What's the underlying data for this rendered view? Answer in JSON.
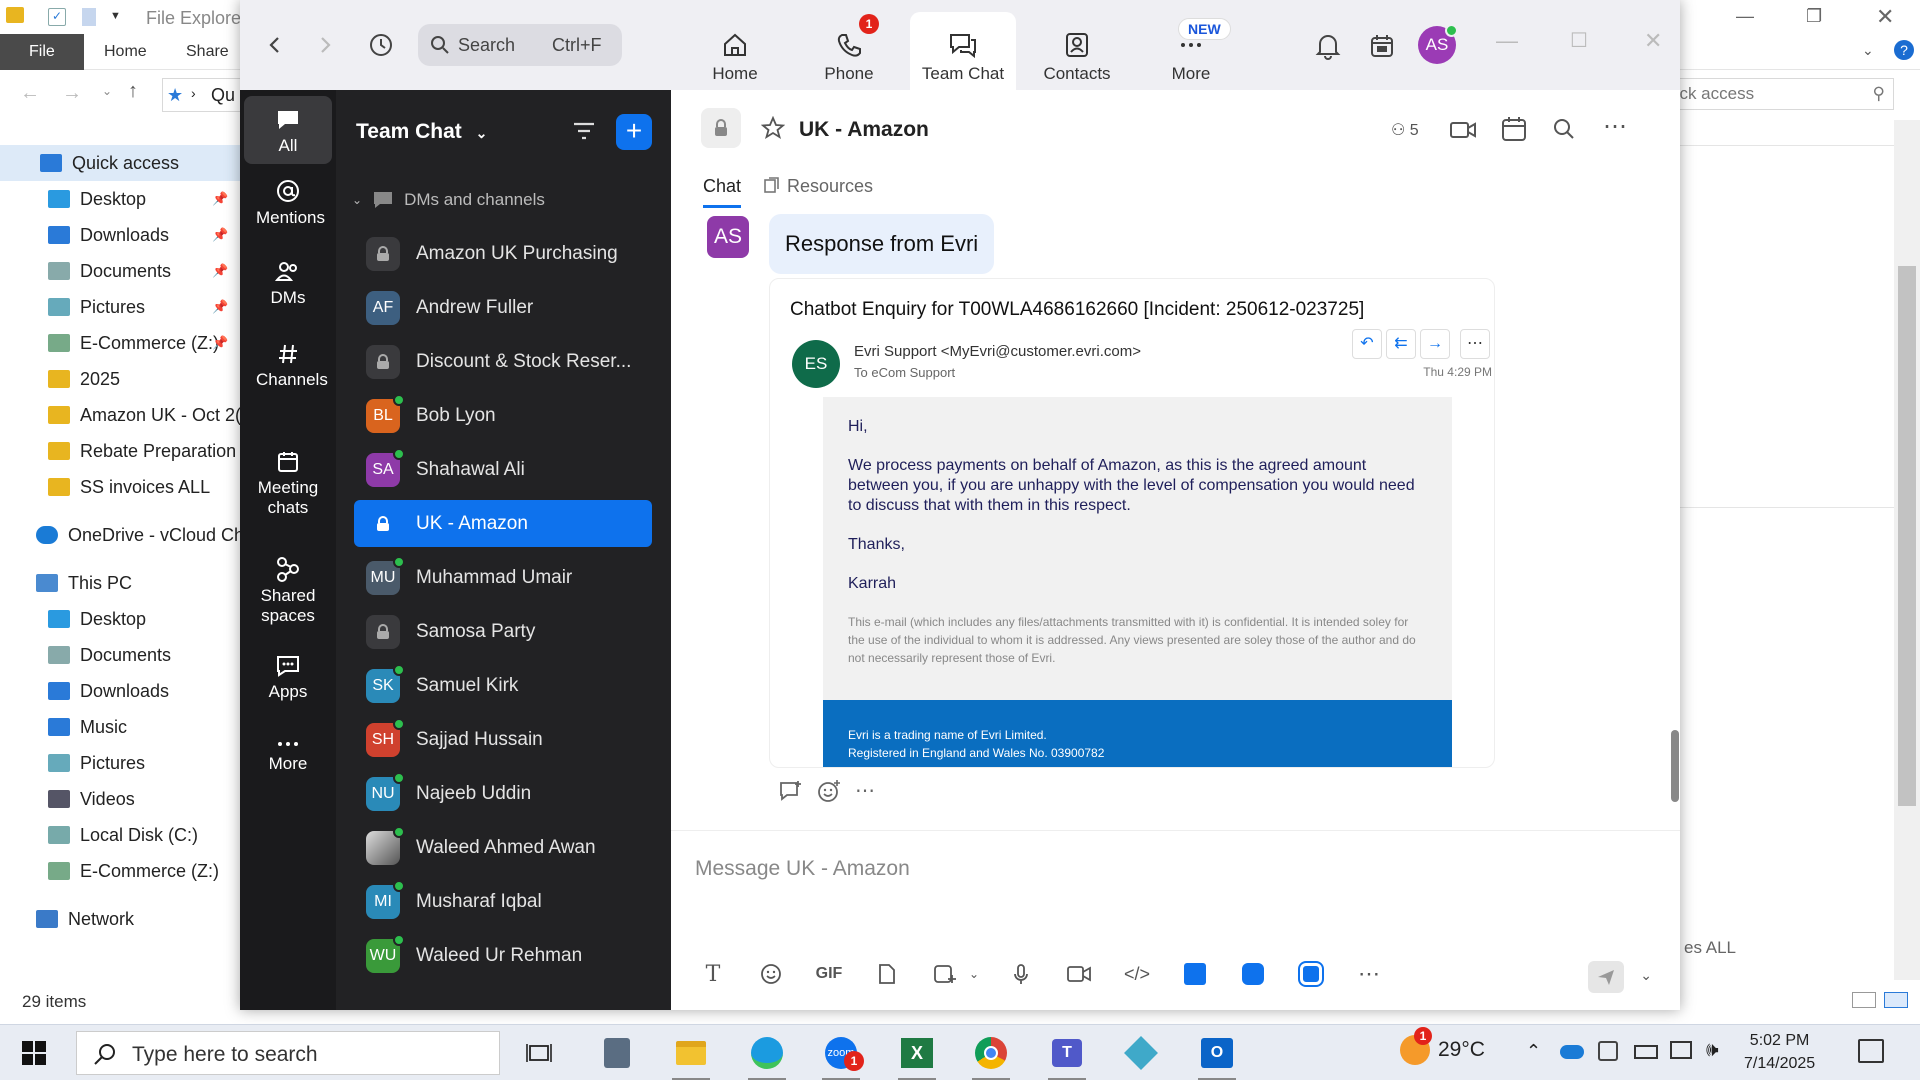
{
  "file_explorer": {
    "title": "File Explorer",
    "tabs": [
      "File",
      "Home",
      "Share"
    ],
    "address": "Qu",
    "quick_access_search": "Quick access",
    "nav_items": [
      {
        "label": "Quick access",
        "icon": "star-icon",
        "pinned": false
      },
      {
        "label": "Desktop",
        "icon": "desktop-folder-icon",
        "pinned": true
      },
      {
        "label": "Downloads",
        "icon": "downloads-icon",
        "pinned": true
      },
      {
        "label": "Documents",
        "icon": "documents-icon",
        "pinned": true
      },
      {
        "label": "Pictures",
        "icon": "pictures-icon",
        "pinned": true
      },
      {
        "label": "E-Commerce (Z:)",
        "icon": "network-drive-icon",
        "pinned": true
      },
      {
        "label": "2025",
        "icon": "folder-icon",
        "pinned": false
      },
      {
        "label": "Amazon UK - Oct 2(",
        "icon": "folder-icon",
        "pinned": false
      },
      {
        "label": "Rebate Preparation",
        "icon": "folder-icon",
        "pinned": false
      },
      {
        "label": "SS invoices ALL",
        "icon": "folder-icon",
        "pinned": false
      },
      {
        "label": "OneDrive - vCloud Ch",
        "icon": "onedrive-icon",
        "pinned": false
      },
      {
        "label": "This PC",
        "icon": "pc-icon",
        "pinned": false
      },
      {
        "label": "Desktop",
        "icon": "desktop-folder-icon",
        "pinned": false
      },
      {
        "label": "Documents",
        "icon": "documents-icon",
        "pinned": false
      },
      {
        "label": "Downloads",
        "icon": "downloads-icon",
        "pinned": false
      },
      {
        "label": "Music",
        "icon": "music-icon",
        "pinned": false
      },
      {
        "label": "Pictures",
        "icon": "pictures-icon",
        "pinned": false
      },
      {
        "label": "Videos",
        "icon": "videos-icon",
        "pinned": false
      },
      {
        "label": "Local Disk (C:)",
        "icon": "local-disk-icon",
        "pinned": false
      },
      {
        "label": "E-Commerce (Z:)",
        "icon": "network-drive-icon",
        "pinned": false
      },
      {
        "label": "Network",
        "icon": "network-icon",
        "pinned": false
      }
    ],
    "status": "29 items",
    "cut_text": "es ALL"
  },
  "zoom": {
    "search": {
      "label": "Search",
      "shortcut": "Ctrl+F"
    },
    "nav_tabs": [
      {
        "label": "Home",
        "icon": "home-icon",
        "active": false
      },
      {
        "label": "Phone",
        "icon": "phone-icon",
        "active": false,
        "badge": "1"
      },
      {
        "label": "Team Chat",
        "icon": "chat-icon",
        "active": true
      },
      {
        "label": "Contacts",
        "icon": "contacts-icon",
        "active": false
      },
      {
        "label": "More",
        "icon": "more-icon",
        "active": false
      }
    ],
    "new_badge": "NEW",
    "profile_initials": "AS",
    "rail": [
      {
        "label": "All",
        "icon": "all-chat-icon",
        "active": true
      },
      {
        "label": "Mentions",
        "icon": "at-icon",
        "active": false
      },
      {
        "label": "DMs",
        "icon": "people-icon",
        "active": false
      },
      {
        "label": "Channels",
        "icon": "hash-icon",
        "active": false
      },
      {
        "label": "Meeting chats",
        "icon": "calendar-icon",
        "active": false
      },
      {
        "label": "Shared spaces",
        "icon": "shared-spaces-icon",
        "active": false
      },
      {
        "label": "Apps",
        "icon": "apps-icon",
        "active": false
      },
      {
        "label": "More",
        "icon": "more-dots-icon",
        "active": false
      }
    ],
    "channel_list": {
      "title": "Team Chat",
      "section": "DMs and channels",
      "items": [
        {
          "label": "Amazon UK Purchasing",
          "type": "lock",
          "initials": "",
          "color": "#3a3a3d",
          "online": false
        },
        {
          "label": "Andrew Fuller",
          "type": "avatar",
          "initials": "AF",
          "color": "#3d5f80",
          "online": false
        },
        {
          "label": "Discount & Stock Reser...",
          "type": "lock",
          "initials": "",
          "color": "#3a3a3d",
          "online": false
        },
        {
          "label": "Bob Lyon",
          "type": "avatar",
          "initials": "BL",
          "color": "#d9641e",
          "online": true
        },
        {
          "label": "Shahawal Ali",
          "type": "avatar",
          "initials": "SA",
          "color": "#8e3aa8",
          "online": true
        },
        {
          "label": "UK - Amazon",
          "type": "lock",
          "initials": "",
          "color": "#0e72ed",
          "online": false,
          "active": true
        },
        {
          "label": "Muhammad Umair",
          "type": "avatar",
          "initials": "MU",
          "color": "#4a5a6a",
          "online": true
        },
        {
          "label": "Samosa Party",
          "type": "lock",
          "initials": "",
          "color": "#3a3a3d",
          "online": false
        },
        {
          "label": "Samuel Kirk",
          "type": "avatar",
          "initials": "SK",
          "color": "#2a8ab8",
          "online": true
        },
        {
          "label": "Sajjad Hussain",
          "type": "avatar",
          "initials": "SH",
          "color": "#d0412e",
          "online": true
        },
        {
          "label": "Najeeb Uddin",
          "type": "avatar",
          "initials": "NU",
          "color": "#2a8ab8",
          "online": true
        },
        {
          "label": "Waleed Ahmed Awan",
          "type": "photo",
          "initials": "",
          "color": "#777",
          "online": true
        },
        {
          "label": "Musharaf Iqbal",
          "type": "avatar",
          "initials": "MI",
          "color": "#2a8ab8",
          "online": true
        },
        {
          "label": "Waleed Ur Rehman",
          "type": "avatar",
          "initials": "WU",
          "color": "#3a9a3a",
          "online": true
        }
      ]
    },
    "chat": {
      "title": "UK - Amazon",
      "members": "5",
      "tabs": [
        "Chat",
        "Resources"
      ],
      "sender_initials": "AS",
      "bubble": "Response from Evri",
      "email_subject": "Chatbot Enquiry for T00WLA4686162660 [Incident: 250612-023725]",
      "from": "Evri Support <MyEvri@customer.evri.com>",
      "to": "To  eCom Support",
      "time": "Thu 4:29 PM",
      "from_initials": "ES",
      "email_lines": [
        "Hi,",
        "We process payments on behalf of Amazon, as this is the agreed amount between you, if you are unhappy with the level of compensation you would need to discuss that with them in this respect.",
        "Thanks,",
        "Karrah"
      ],
      "disclaimer": "This e-mail (which includes any files/attachments transmitted with it) is confidential. It is intended soley for the use of the individual to whom it is addressed. Any views presented are soley those of the author and do not necessarily represent those of Evri.",
      "footer": [
        "Evri is a trading name of Evri Limited.",
        "Registered in England and Wales No. 03900782"
      ],
      "compose_placeholder": "Message UK - Amazon",
      "gif_label": "GIF"
    }
  },
  "taskbar": {
    "search_placeholder": "Type here to search",
    "weather": "29°C",
    "weather_badge": "1",
    "zoom_badge": "1",
    "time": "5:02 PM",
    "date": "7/14/2025"
  }
}
